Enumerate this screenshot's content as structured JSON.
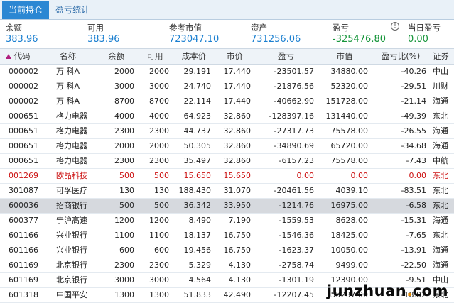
{
  "tabs": [
    {
      "label": "当前持仓",
      "active": true
    },
    {
      "label": "盈亏统计",
      "active": false
    }
  ],
  "summary": [
    {
      "label": "余额",
      "value": "383.96",
      "color": "blue"
    },
    {
      "label": "可用",
      "value": "383.96",
      "color": "blue"
    },
    {
      "label": "参考市值",
      "value": "723047.10",
      "color": "blue"
    },
    {
      "label": "资产",
      "value": "731256.06",
      "color": "blue"
    },
    {
      "label": "盈亏",
      "value": "-325476.80",
      "color": "green",
      "icon": "info-icon"
    },
    {
      "label": "当日盈亏",
      "value": "0.00",
      "color": "green"
    }
  ],
  "columns": [
    "代码",
    "名称",
    "余额",
    "可用",
    "成本价",
    "市价",
    "盈亏",
    "市值",
    "盈亏比(%)",
    "证券"
  ],
  "rows": [
    {
      "code": "000002",
      "name": "万  科A",
      "balance": "2000",
      "avail": "2000",
      "cost": "29.191",
      "price": "17.440",
      "pnl": "-23501.57",
      "mv": "34880.00",
      "pct": "-40.26",
      "acct": "中山",
      "style": ""
    },
    {
      "code": "000002",
      "name": "万  科A",
      "balance": "3000",
      "avail": "3000",
      "cost": "24.740",
      "price": "17.440",
      "pnl": "-21876.56",
      "mv": "52320.00",
      "pct": "-29.51",
      "acct": "川财",
      "style": ""
    },
    {
      "code": "000002",
      "name": "万  科A",
      "balance": "8700",
      "avail": "8700",
      "cost": "22.114",
      "price": "17.440",
      "pnl": "-40662.90",
      "mv": "151728.00",
      "pct": "-21.14",
      "acct": "海通",
      "style": ""
    },
    {
      "code": "000651",
      "name": "格力电器",
      "balance": "4000",
      "avail": "4000",
      "cost": "64.923",
      "price": "32.860",
      "pnl": "-128397.16",
      "mv": "131440.00",
      "pct": "-49.39",
      "acct": "东北",
      "style": ""
    },
    {
      "code": "000651",
      "name": "格力电器",
      "balance": "2300",
      "avail": "2300",
      "cost": "44.737",
      "price": "32.860",
      "pnl": "-27317.73",
      "mv": "75578.00",
      "pct": "-26.55",
      "acct": "海通",
      "style": ""
    },
    {
      "code": "000651",
      "name": "格力电器",
      "balance": "2000",
      "avail": "2000",
      "cost": "50.305",
      "price": "32.860",
      "pnl": "-34890.69",
      "mv": "65720.00",
      "pct": "-34.68",
      "acct": "海通",
      "style": ""
    },
    {
      "code": "000651",
      "name": "格力电器",
      "balance": "2300",
      "avail": "2300",
      "cost": "35.497",
      "price": "32.860",
      "pnl": "-6157.23",
      "mv": "75578.00",
      "pct": "-7.43",
      "acct": "中航",
      "style": ""
    },
    {
      "code": "001269",
      "name": "欧晶科技",
      "balance": "500",
      "avail": "500",
      "cost": "15.650",
      "price": "15.650",
      "pnl": "0.00",
      "mv": "0.00",
      "pct": "0.00",
      "acct": "东北",
      "style": "red"
    },
    {
      "code": "301087",
      "name": "可孚医疗",
      "balance": "130",
      "avail": "130",
      "cost": "188.430",
      "price": "31.070",
      "pnl": "-20461.56",
      "mv": "4039.10",
      "pct": "-83.51",
      "acct": "东北",
      "style": ""
    },
    {
      "code": "600036",
      "name": "招商银行",
      "balance": "500",
      "avail": "500",
      "cost": "36.342",
      "price": "33.950",
      "pnl": "-1214.76",
      "mv": "16975.00",
      "pct": "-6.58",
      "acct": "东北",
      "style": "sel"
    },
    {
      "code": "600377",
      "name": "宁沪高速",
      "balance": "1200",
      "avail": "1200",
      "cost": "8.490",
      "price": "7.190",
      "pnl": "-1559.53",
      "mv": "8628.00",
      "pct": "-15.31",
      "acct": "海通",
      "style": ""
    },
    {
      "code": "601166",
      "name": "兴业银行",
      "balance": "1100",
      "avail": "1100",
      "cost": "18.137",
      "price": "16.750",
      "pnl": "-1546.36",
      "mv": "18425.00",
      "pct": "-7.65",
      "acct": "东北",
      "style": ""
    },
    {
      "code": "601166",
      "name": "兴业银行",
      "balance": "600",
      "avail": "600",
      "cost": "19.456",
      "price": "16.750",
      "pnl": "-1623.37",
      "mv": "10050.00",
      "pct": "-13.91",
      "acct": "海通",
      "style": ""
    },
    {
      "code": "601169",
      "name": "北京银行",
      "balance": "2300",
      "avail": "2300",
      "cost": "5.329",
      "price": "4.130",
      "pnl": "-2758.74",
      "mv": "9499.00",
      "pct": "-22.50",
      "acct": "海通",
      "style": ""
    },
    {
      "code": "601169",
      "name": "北京银行",
      "balance": "3000",
      "avail": "3000",
      "cost": "4.564",
      "price": "4.130",
      "pnl": "-1301.19",
      "mv": "12390.00",
      "pct": "-9.51",
      "acct": "中山",
      "style": ""
    },
    {
      "code": "601318",
      "name": "中国平安",
      "balance": "1300",
      "avail": "1300",
      "cost": "51.833",
      "price": "42.490",
      "pnl": "-12207.45",
      "mv": "55237.00",
      "pct": "-18.02",
      "acct": "东北",
      "style": ""
    }
  ],
  "watermark": {
    "pre": "junzhuan",
    "dot": ".",
    "post": "com"
  }
}
